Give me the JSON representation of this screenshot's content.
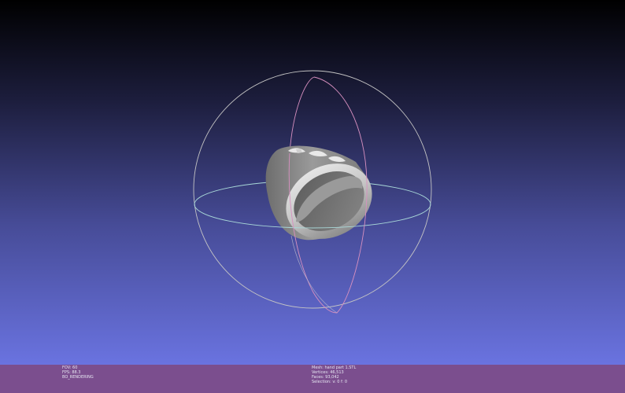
{
  "viewer": {
    "background_top": "#000000",
    "background_bottom": "#6a73e0",
    "statusbar_color": "#7b4e8e",
    "trackball_colors": {
      "horizontal_ring": "#a9d8d8",
      "vertical_ring": "#d890c0",
      "outer_ring": "#c4c4c4"
    },
    "mesh_color": "#8f8f8f"
  },
  "status": {
    "left": {
      "fov": "FOV: 60",
      "fps": "FPS:  88.3",
      "mode": "BO_RENDERING"
    },
    "right": {
      "mesh": "Mesh: hand part 1.STL",
      "vertices": "Vertices: 46,513",
      "faces": "Faces: 93,042",
      "selection": "Selection: v: 0 f: 0"
    }
  }
}
